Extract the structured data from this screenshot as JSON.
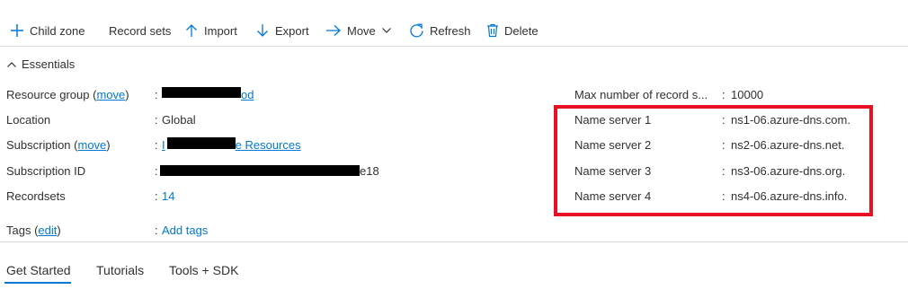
{
  "toolbar": {
    "child_zone": "Child zone",
    "record_sets": "Record sets",
    "import": "Import",
    "export": "Export",
    "move": "Move",
    "refresh": "Refresh",
    "delete": "Delete"
  },
  "essentials": {
    "label": "Essentials"
  },
  "left_fields": {
    "resource_group": {
      "label": "Resource group (",
      "link": "move",
      "close": ")",
      "value_visible": "od"
    },
    "location": {
      "label": "Location",
      "value": "Global"
    },
    "subscription": {
      "label": "Subscription (",
      "link": "move",
      "close": ")",
      "value_prefix": "I",
      "value_visible": "e Resources"
    },
    "subscription_id": {
      "label": "Subscription ID",
      "value_visible": "e18"
    },
    "recordsets": {
      "label": "Recordsets",
      "value": "14"
    }
  },
  "right_fields": {
    "max_records": {
      "label": "Max number of record s...",
      "value": "10000"
    },
    "ns1": {
      "label": "Name server 1",
      "value": "ns1-06.azure-dns.com."
    },
    "ns2": {
      "label": "Name server 2",
      "value": "ns2-06.azure-dns.net."
    },
    "ns3": {
      "label": "Name server 3",
      "value": "ns3-06.azure-dns.org."
    },
    "ns4": {
      "label": "Name server 4",
      "value": "ns4-06.azure-dns.info."
    }
  },
  "tags": {
    "label": "Tags (",
    "link": "edit",
    "close": ")",
    "add": "Add tags"
  },
  "tabs": {
    "get_started": "Get Started",
    "tutorials": "Tutorials",
    "tools_sdk": "Tools + SDK"
  },
  "colon": ":",
  "colors": {
    "accent": "#0078d4",
    "highlight": "#e81123",
    "text": "#323130"
  }
}
